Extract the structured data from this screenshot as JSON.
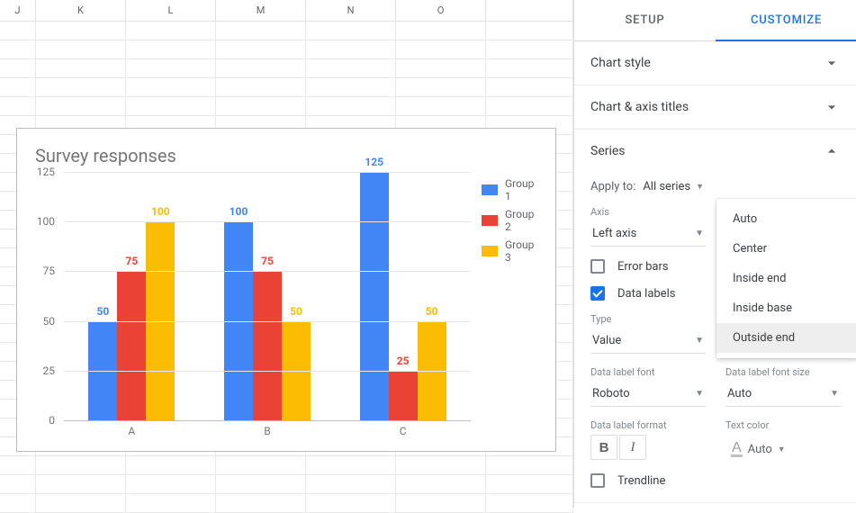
{
  "columns": [
    "J",
    "K",
    "L",
    "M",
    "N",
    "O",
    ""
  ],
  "chart_data": {
    "type": "bar",
    "title": "Survey responses",
    "categories": [
      "A",
      "B",
      "C"
    ],
    "series": [
      {
        "name": "Group 1",
        "color": "#4285f4",
        "values": [
          50,
          100,
          125
        ]
      },
      {
        "name": "Group 2",
        "color": "#ea4335",
        "values": [
          75,
          75,
          25
        ]
      },
      {
        "name": "Group 3",
        "color": "#fbbc04",
        "values": [
          100,
          50,
          50
        ]
      }
    ],
    "ylim": [
      0,
      125
    ],
    "yticks": [
      0,
      25,
      50,
      75,
      100,
      125
    ]
  },
  "sidebar": {
    "tabs": {
      "setup": "SETUP",
      "customize": "CUSTOMIZE"
    },
    "sections": {
      "chart_style": "Chart style",
      "chart_axis_titles": "Chart & axis titles",
      "series": "Series"
    },
    "series": {
      "apply_label": "Apply to:",
      "apply_value": "All series",
      "axis_label": "Axis",
      "axis_value": "Left axis",
      "position_dropdown": {
        "options": [
          "Auto",
          "Center",
          "Inside end",
          "Inside base",
          "Outside end"
        ],
        "highlighted": "Outside end"
      },
      "error_bars": "Error bars",
      "data_labels": "Data labels",
      "type_label": "Type",
      "type_value": "Value",
      "font_label": "Data label font",
      "font_value": "Roboto",
      "font_size_label": "Data label font size",
      "font_size_value": "Auto",
      "format_label": "Data label format",
      "text_color_label": "Text color",
      "text_color_value": "Auto",
      "trendline": "Trendline"
    }
  }
}
